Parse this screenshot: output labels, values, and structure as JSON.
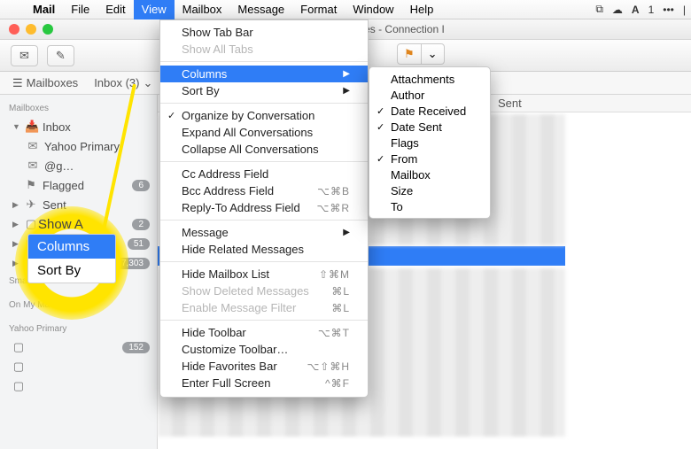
{
  "menubar": {
    "app": "Mail",
    "items": [
      "File",
      "Edit",
      "View",
      "Mailbox",
      "Message",
      "Format",
      "Window",
      "Help"
    ],
    "active": "View",
    "right_indicators": [
      "dropbox",
      "cloud",
      "adobe",
      "1",
      "more"
    ]
  },
  "window": {
    "title_suffix": "@gmail.com (34 messages - Connection I"
  },
  "toolbar": {
    "mail_icon": "✉",
    "compose_icon": "✎",
    "flag_icon": "⚑"
  },
  "tabs": {
    "mailboxes": "Mailboxes",
    "inbox": "Inbox (3)"
  },
  "sidebar": {
    "hdr1": "Mailboxes",
    "inbox": "Inbox",
    "yahoo_primary": "Yahoo Primary",
    "gmail_short": "@g…",
    "flagged": "Flagged",
    "sent": "Sent",
    "row_a_badge": "2",
    "row_b_badge": "51",
    "row_c_badge": "7,303",
    "smart": "Smart Ma",
    "onmymac": "On My Mac",
    "yahoo_hdr": "Yahoo Primary",
    "folder_badge": "152",
    "flagged_badge": "6"
  },
  "view_menu": {
    "show_tab_bar": "Show Tab Bar",
    "show_all_tabs": "Show All Tabs",
    "columns": "Columns",
    "sort_by": "Sort By",
    "organize": "Organize by Conversation",
    "expand_all": "Expand All Conversations",
    "collapse_all": "Collapse All Conversations",
    "cc": "Cc Address Field",
    "bcc": "Bcc Address Field",
    "bcc_sc": "⌥⌘B",
    "replyto": "Reply-To Address Field",
    "replyto_sc": "⌥⌘R",
    "message": "Message",
    "hide_related": "Hide Related Messages",
    "hide_mailbox_list": "Hide Mailbox List",
    "hide_mailbox_sc": "⇧⌘M",
    "show_deleted": "Show Deleted Messages",
    "show_deleted_sc": "⌘L",
    "enable_filter": "Enable Message Filter",
    "enable_filter_sc": "⌘L",
    "hide_toolbar": "Hide Toolbar",
    "hide_toolbar_sc": "⌥⌘T",
    "customize_toolbar": "Customize Toolbar…",
    "hide_favorites": "Hide Favorites Bar",
    "hide_favorites_sc": "⌥⇧⌘H",
    "full_screen": "Enter Full Screen",
    "full_screen_sc": "^⌘F"
  },
  "columns_submenu": {
    "attachments": "Attachments",
    "author": "Author",
    "date_received": "Date Received",
    "date_sent": "Date Sent",
    "flags": "Flags",
    "from": "From",
    "mailbox": "Mailbox",
    "size": "Size",
    "to": "To"
  },
  "content_headers": {
    "sent": "Sent"
  },
  "callout": {
    "show_a": "Show A",
    "columns": "Columns",
    "sort_by": "Sort By"
  }
}
